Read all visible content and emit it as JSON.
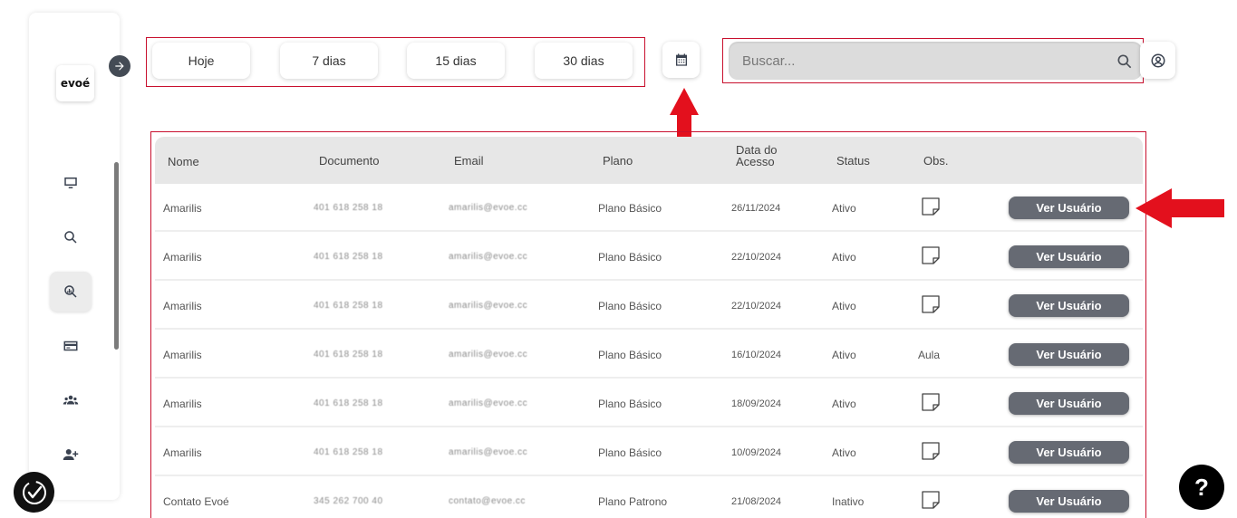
{
  "sidebar": {
    "logo": "evoé",
    "items": [
      {
        "icon": "monitor-icon"
      },
      {
        "icon": "search-icon"
      },
      {
        "icon": "analytics-search-icon",
        "active": true
      },
      {
        "icon": "credit-card-icon"
      },
      {
        "icon": "users-group-icon"
      },
      {
        "icon": "add-user-icon"
      }
    ]
  },
  "filters": {
    "today": "Hoje",
    "days7": "7 dias",
    "days15": "15 dias",
    "days30": "30 dias"
  },
  "search": {
    "placeholder": "Buscar..."
  },
  "table": {
    "headers": {
      "name": "Nome",
      "document": "Documento",
      "email": "Email",
      "plan": "Plano",
      "access_date_line1": "Data do",
      "access_date_line2": "Acesso",
      "status": "Status",
      "obs": "Obs."
    },
    "button_label": "Ver Usuário",
    "rows": [
      {
        "name": "Amarilis",
        "document": "401 618 258 18",
        "email": "amarilis@evoe.cc",
        "plan": "Plano Básico",
        "date": "26/11/2024",
        "status": "Ativo",
        "obs": ""
      },
      {
        "name": "Amarilis",
        "document": "401 618 258 18",
        "email": "amarilis@evoe.cc",
        "plan": "Plano Básico",
        "date": "22/10/2024",
        "status": "Ativo",
        "obs": ""
      },
      {
        "name": "Amarilis",
        "document": "401 618 258 18",
        "email": "amarilis@evoe.cc",
        "plan": "Plano Básico",
        "date": "22/10/2024",
        "status": "Ativo",
        "obs": ""
      },
      {
        "name": "Amarilis",
        "document": "401 618 258 18",
        "email": "amarilis@evoe.cc",
        "plan": "Plano Básico",
        "date": "16/10/2024",
        "status": "Ativo",
        "obs": "Aula"
      },
      {
        "name": "Amarilis",
        "document": "401 618 258 18",
        "email": "amarilis@evoe.cc",
        "plan": "Plano Básico",
        "date": "18/09/2024",
        "status": "Ativo",
        "obs": ""
      },
      {
        "name": "Amarilis",
        "document": "401 618 258 18",
        "email": "amarilis@evoe.cc",
        "plan": "Plano Básico",
        "date": "10/09/2024",
        "status": "Ativo",
        "obs": ""
      },
      {
        "name": "Contato Evoé",
        "document": "345 262 700 40",
        "email": "contato@evoe.cc",
        "plan": "Plano Patrono",
        "date": "21/08/2024",
        "status": "Inativo",
        "obs": ""
      }
    ]
  },
  "help": {
    "label": "?"
  },
  "colors": {
    "highlight_border": "#c8102e",
    "arrow": "#e3101d",
    "button_bg": "#666a73",
    "header_bg": "#e7e7e7"
  }
}
